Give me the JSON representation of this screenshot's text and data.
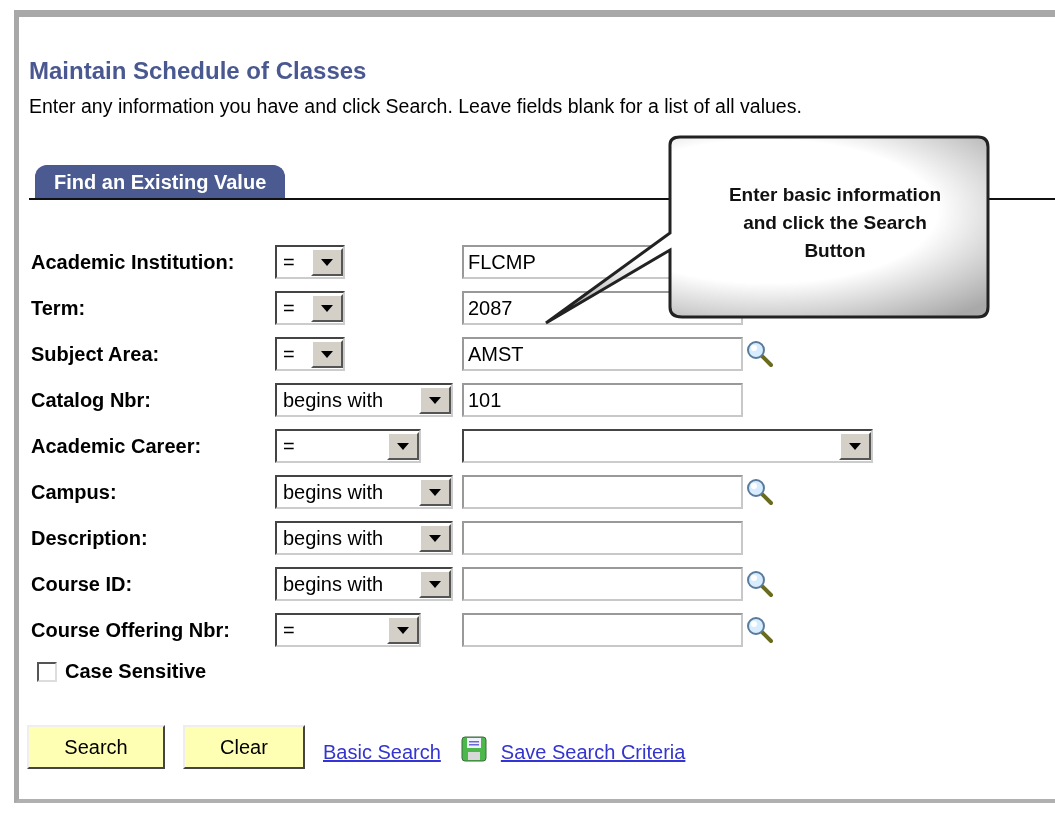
{
  "page": {
    "title": "Maintain Schedule of Classes",
    "instructions": "Enter any information you have and click Search. Leave fields blank for a list of all values."
  },
  "tabs": [
    {
      "label": "Find an Existing Value",
      "selected": true
    }
  ],
  "callout": {
    "text": "Enter basic information and click the Search Button"
  },
  "criteria": [
    {
      "label": "Academic Institution:",
      "operator": {
        "value": "=",
        "kind": "short"
      },
      "value": {
        "kind": "text",
        "text": "FLCMP"
      }
    },
    {
      "label": "Term:",
      "operator": {
        "value": "=",
        "kind": "short"
      },
      "value": {
        "kind": "text",
        "text": "2087"
      }
    },
    {
      "label": "Subject Area:",
      "operator": {
        "value": "=",
        "kind": "short"
      },
      "value": {
        "kind": "lookup",
        "text": "AMST"
      }
    },
    {
      "label": "Catalog Nbr:",
      "operator": {
        "value": "begins with",
        "kind": "long"
      },
      "value": {
        "kind": "text",
        "text": "101"
      }
    },
    {
      "label": "Academic Career:",
      "operator": {
        "value": "=",
        "kind": "medium"
      },
      "value": {
        "kind": "dropdown"
      }
    },
    {
      "label": "Campus:",
      "operator": {
        "value": "begins with",
        "kind": "long"
      },
      "value": {
        "kind": "lookup"
      }
    },
    {
      "label": "Description:",
      "operator": {
        "value": "begins with",
        "kind": "long"
      },
      "value": {
        "kind": "text"
      }
    },
    {
      "label": "Course ID:",
      "operator": {
        "value": "begins with",
        "kind": "long"
      },
      "value": {
        "kind": "lookup"
      }
    },
    {
      "label": "Course Offering Nbr:",
      "operator": {
        "value": "=",
        "kind": "medium"
      },
      "value": {
        "kind": "lookup"
      }
    }
  ],
  "case_sensitive": {
    "label": "Case Sensitive",
    "checked": false
  },
  "buttons": [
    "Search",
    "Clear"
  ],
  "links": [
    {
      "label": "Basic Search",
      "icon": false
    },
    {
      "label": "Save Search Criteria",
      "icon": true
    }
  ]
}
